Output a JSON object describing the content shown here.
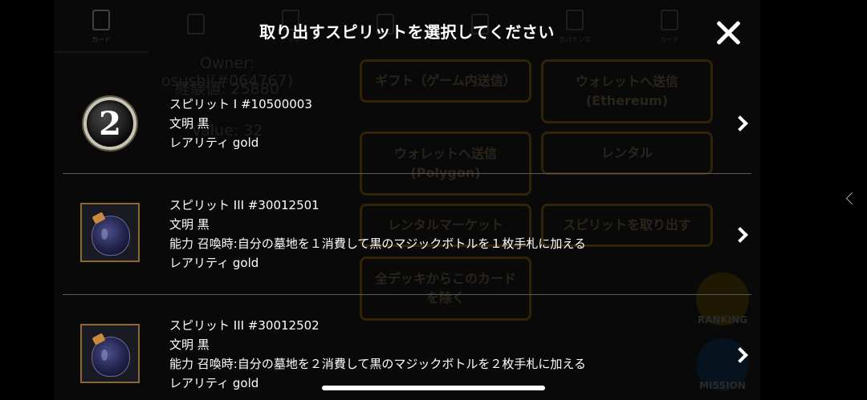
{
  "background": {
    "tabs": [
      {
        "label": "カード",
        "active": true
      },
      {
        "label": "",
        "active": false
      },
      {
        "label": "デッキ",
        "active": false
      },
      {
        "label": "",
        "active": false
      },
      {
        "label": "",
        "active": false
      },
      {
        "label": "ガバナンス",
        "active": false
      },
      {
        "label": "カード",
        "active": false
      }
    ],
    "card_info": {
      "owner": "Owner: osushi(#064767)",
      "exp": "経験値: 25880",
      "value": "Value: 32"
    },
    "buttons": {
      "gift": "ギフト（ゲーム内送信）",
      "send_wallet_eth": "ウォレットへ送信\n(Ethereum)",
      "send_wallet_polygon": "ウォレットへ送信\n(Polygon)",
      "rental": "レンタル",
      "rental_market": "レンタルマーケット",
      "extract_spirit": "スピリットを取り出す",
      "remove_from_all_decks": "全デッキからこのカード\nを除く"
    },
    "side": {
      "ranking": "RANKING",
      "mission": "MISSION"
    }
  },
  "modal": {
    "title": "取り出すスピリットを選択してください",
    "items": [
      {
        "name": "スピリット I #10500003",
        "civilization": "文明 黒",
        "ability": "",
        "rarity": "レアリティ gold",
        "thumb_icon": "spirit-badge-2-icon",
        "thumb_text": "2"
      },
      {
        "name": "スピリット III #30012501",
        "civilization": "文明 黒",
        "ability": "能力 召喚時:自分の墓地を１消費して黒のマジックボトルを１枚手札に加える",
        "rarity": "レアリティ gold",
        "thumb_icon": "magic-bottle-icon"
      },
      {
        "name": "スピリット III #30012502",
        "civilization": "文明 黒",
        "ability": "能力 召喚時:自分の墓地を２消費して黒のマジックボトルを２枚手札に加える",
        "rarity": "レアリティ gold",
        "thumb_icon": "magic-bottle-icon"
      }
    ]
  },
  "colors": {
    "accent_gold": "#5a3e10",
    "text": "#ffffff",
    "divider": "#5a5a5a"
  }
}
